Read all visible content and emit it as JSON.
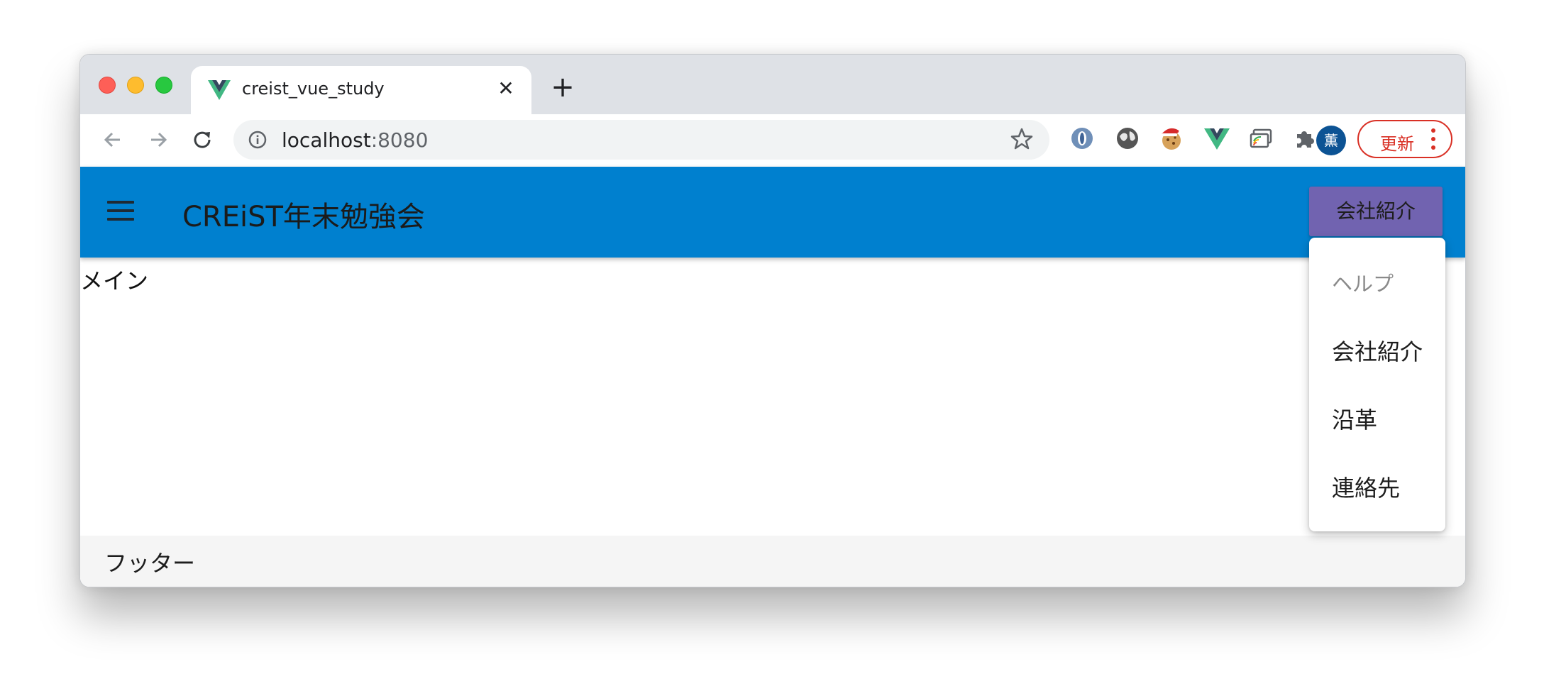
{
  "browser": {
    "tab_title": "creist_vue_study",
    "tab_close": "✕",
    "new_tab": "+",
    "url_host": "localhost",
    "url_port": ":8080",
    "profile_initial": "薫",
    "update_label": "更新",
    "extension_icons": [
      "opera-icon",
      "globe-icon",
      "cookie-icon",
      "vue-devtools-icon",
      "cast-icon",
      "puzzle-icon"
    ]
  },
  "app": {
    "title": "CREiST年末勉強会",
    "menu_button": "会社紹介",
    "main_text": "メイン",
    "footer_text": "フッター",
    "colors": {
      "appbar": "#0080cf",
      "menu_button": "#7163b0",
      "update": "#d93025"
    }
  },
  "dropdown": {
    "items": [
      {
        "label": "ヘルプ",
        "disabled": true
      },
      {
        "label": "会社紹介",
        "disabled": false
      },
      {
        "label": "沿革",
        "disabled": false
      },
      {
        "label": "連絡先",
        "disabled": false
      }
    ]
  }
}
